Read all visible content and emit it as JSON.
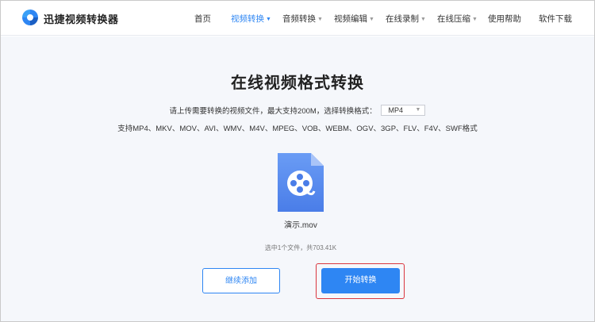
{
  "header": {
    "brand": "迅捷视频转换器",
    "nav": [
      {
        "label": "首页",
        "dropdown": false,
        "active": false
      },
      {
        "label": "视频转换",
        "dropdown": true,
        "active": true
      },
      {
        "label": "音频转换",
        "dropdown": true,
        "active": false
      },
      {
        "label": "视频编辑",
        "dropdown": true,
        "active": false
      },
      {
        "label": "在线录制",
        "dropdown": true,
        "active": false
      },
      {
        "label": "在线压缩",
        "dropdown": true,
        "active": false
      },
      {
        "label": "使用帮助",
        "dropdown": false,
        "active": false
      },
      {
        "label": "软件下载",
        "dropdown": false,
        "active": false
      }
    ]
  },
  "main": {
    "title": "在线视频格式转换",
    "upload_hint": "请上传需要转换的视频文件，最大支持200M，选择转换格式：",
    "format_select": {
      "selected": "MP4"
    },
    "supported_formats": "支持MP4、MKV、MOV、AVI、WMV、M4V、MPEG、VOB、WEBM、OGV、3GP、FLV、F4V、SWF格式",
    "file": {
      "name": "演示.mov",
      "icon": "video-file-icon"
    },
    "selection_info": "选中1个文件，共703.41K",
    "continue_button": "继续添加",
    "start_button": "开始转换"
  },
  "colors": {
    "accent": "#2e86f3",
    "highlight_border": "#d9363e",
    "page_background": "#f5f7fb",
    "file_icon": "#5b8cf0"
  }
}
